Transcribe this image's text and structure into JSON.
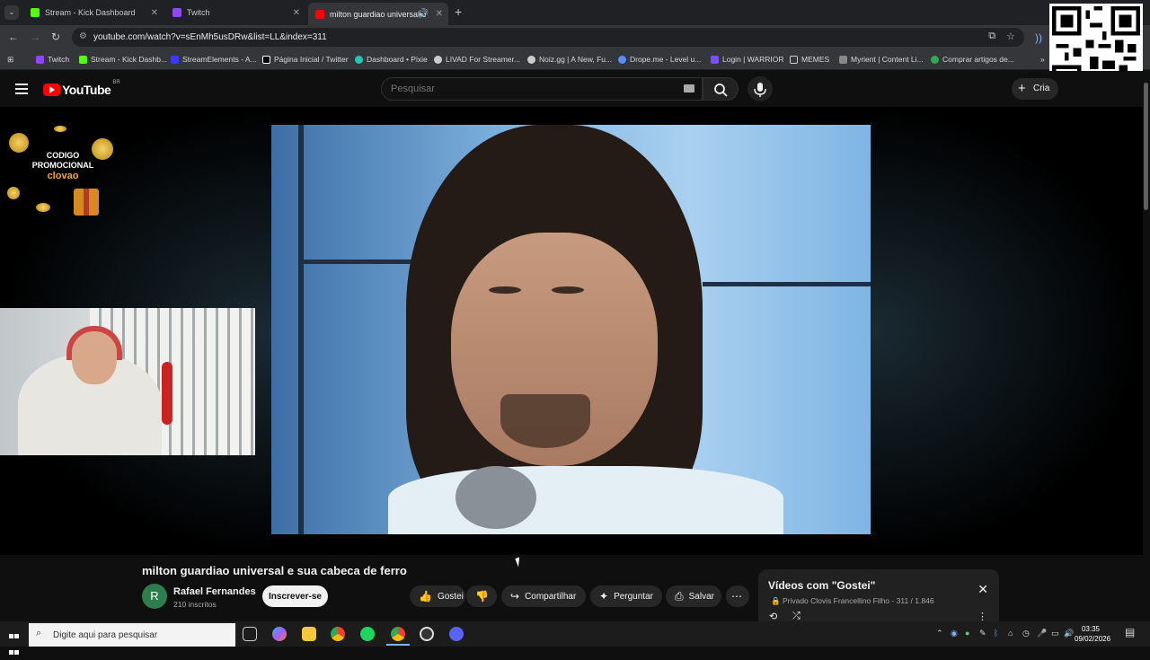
{
  "browser": {
    "tabs": [
      {
        "title": "Stream - Kick Dashboard",
        "color": "#53fc18"
      },
      {
        "title": "Twitch",
        "color": "#9146ff"
      },
      {
        "title": "milton guardiao universal e",
        "color": "#ff0000"
      }
    ],
    "url": "youtube.com/watch?v=sEnMh5usDRw&list=LL&index=311",
    "bookmarks": [
      {
        "label": "Twitch",
        "color": "#9146ff"
      },
      {
        "label": "Stream - Kick Dashb...",
        "color": "#53fc18"
      },
      {
        "label": "StreamElements - A...",
        "color": "#3a3aff"
      },
      {
        "label": "Página Inicial / Twitter",
        "color": "#ffffff"
      },
      {
        "label": "Dashboard • Pixie",
        "color": "#1fc7b8"
      },
      {
        "label": "LIVAD For Streamer...",
        "color": "#cccccc"
      },
      {
        "label": "Noiz.gg | A New, Fu...",
        "color": "#cccccc"
      },
      {
        "label": "Drope.me - Level u...",
        "color": "#5b8cff"
      },
      {
        "label": "Login | WARRIOR",
        "color": "#7b4dff"
      },
      {
        "label": "MEMES",
        "color": "#cccccc"
      },
      {
        "label": "Myrient | Content Li...",
        "color": "#888888"
      },
      {
        "label": "Comprar artigos de...",
        "color": "#34a853"
      }
    ]
  },
  "youtube": {
    "logo_text": "YouTube",
    "region": "BR",
    "search_placeholder": "Pesquisar",
    "create_label": "Cria"
  },
  "overlay": {
    "promo_line1": "CODIGO",
    "promo_line2": "PROMOCIONAL",
    "promo_code": "clovao"
  },
  "video": {
    "title": "milton guardiao universal e sua cabeca de ferro",
    "channel": "Rafael Fernandes",
    "channel_initial": "R",
    "subscribers": "210 inscritos",
    "subscribe_label": "Inscrever-se",
    "like_label": "Gostei",
    "share_label": "Compartilhar",
    "ask_label": "Perguntar",
    "save_label": "Salvar"
  },
  "playlist": {
    "title": "Vídeos com \"Gostei\"",
    "privacy": "Privado",
    "owner": "Clovis Francellino Filho",
    "position": "311 / 1.846"
  },
  "taskbar": {
    "search_placeholder": "Digite aqui para pesquisar",
    "time": "03:35",
    "date": "09/02/2026"
  }
}
